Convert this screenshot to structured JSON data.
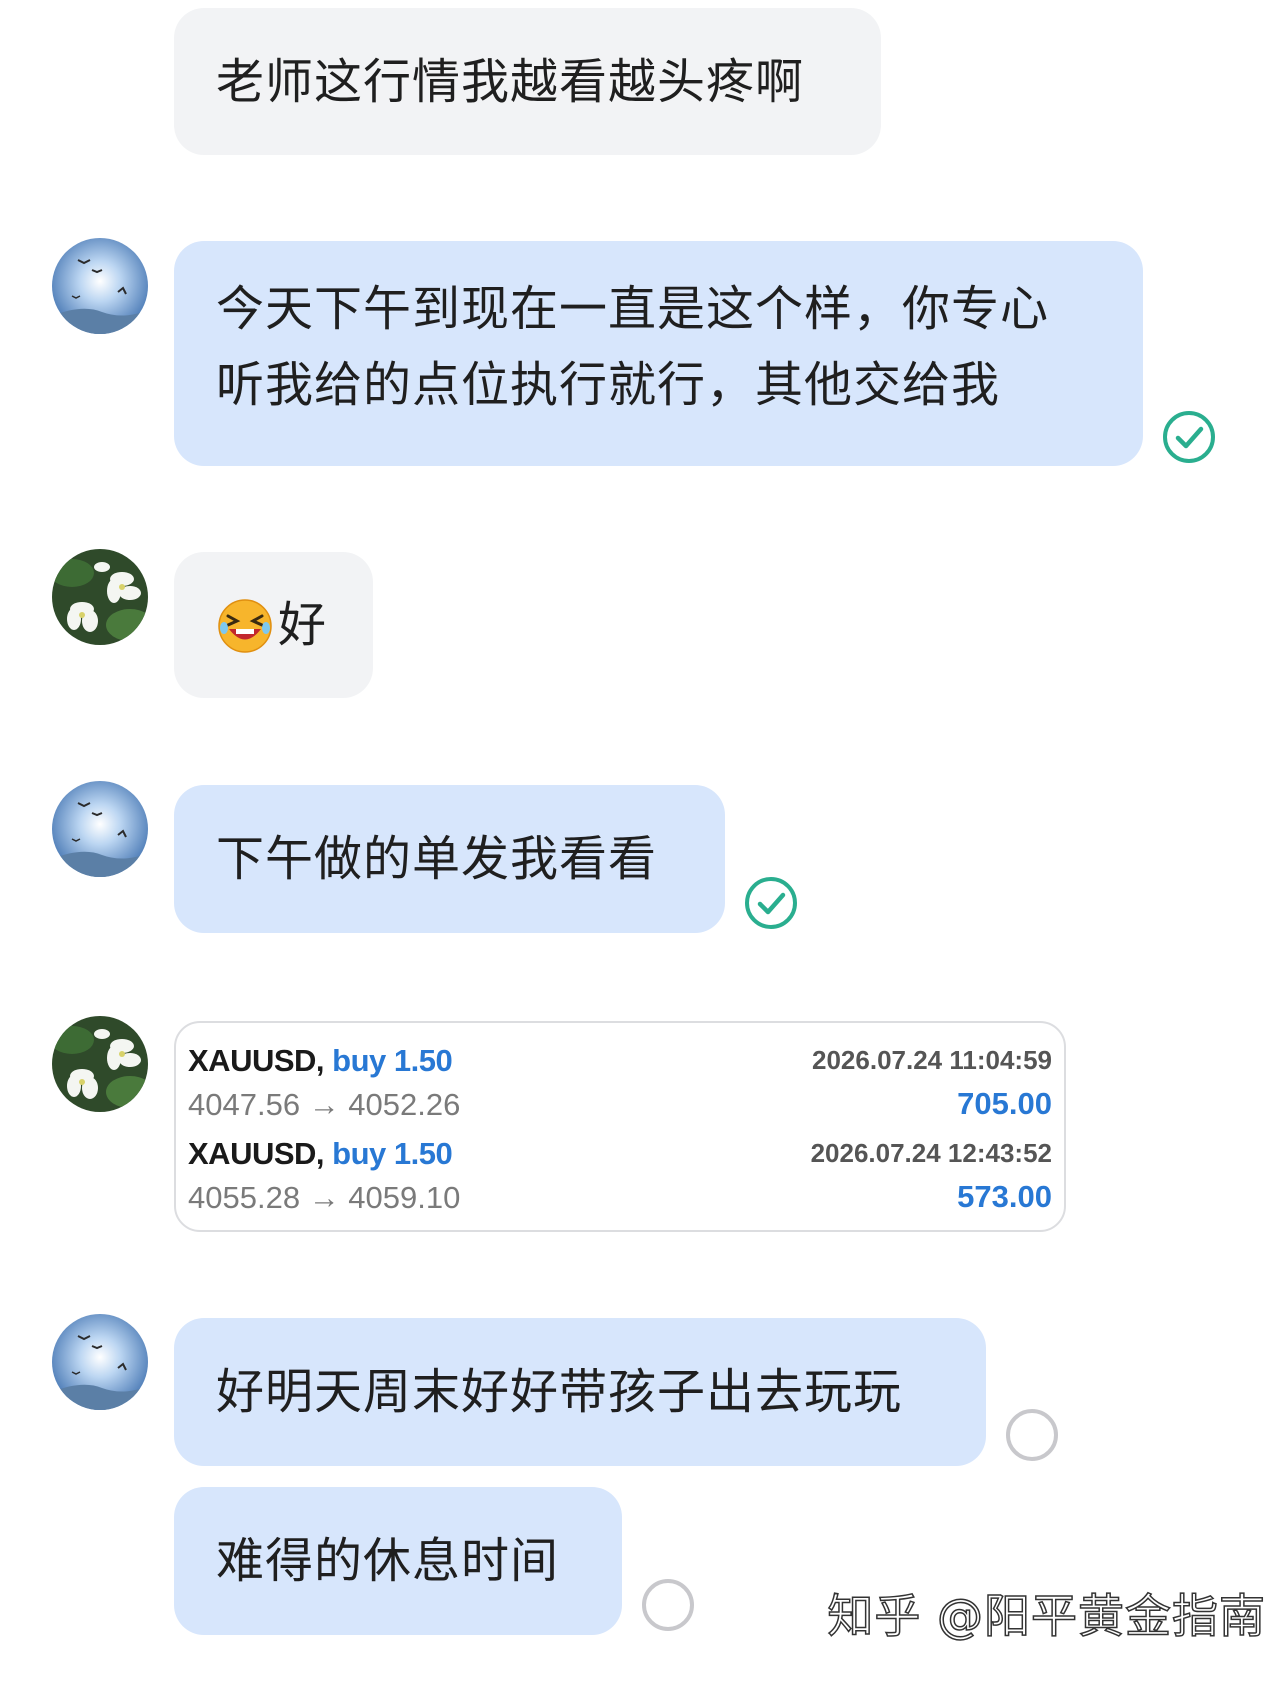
{
  "messages": [
    {
      "text": "老师这行情我越看越头疼啊"
    },
    {
      "lines": [
        "今天下午到现在一直是这个样，你专心",
        "听我给的点位执行就行，其他交给我"
      ],
      "status": "read"
    },
    {
      "text": "好",
      "emoji": "laughing-tears-emoji"
    },
    {
      "text": "下午做的单发我看看",
      "status": "read"
    },
    {
      "trades": [
        {
          "symbol": "XAUUSD,",
          "side": "buy 1.50",
          "prices": "4047.56 → 4052.26",
          "time": "2026.07.24 11:04:59",
          "profit": "705.00"
        },
        {
          "symbol": "XAUUSD,",
          "side": "buy 1.50",
          "prices": "4055.28 → 4059.10",
          "time": "2026.07.24 12:43:52",
          "profit": "573.00"
        }
      ]
    },
    {
      "text": "好明天周末好好带孩子出去玩玩",
      "status": "sent"
    },
    {
      "text": "难得的休息时间",
      "status": "sent"
    }
  ],
  "colors": {
    "incoming_bubble": "#f2f3f5",
    "outgoing_bubble": "#d7e6fc",
    "read_check": "#2aae8f",
    "unread_ring": "#c8c8cc",
    "trade_blue": "#2878d4"
  },
  "watermark": "知乎 @阳平黄金指南"
}
